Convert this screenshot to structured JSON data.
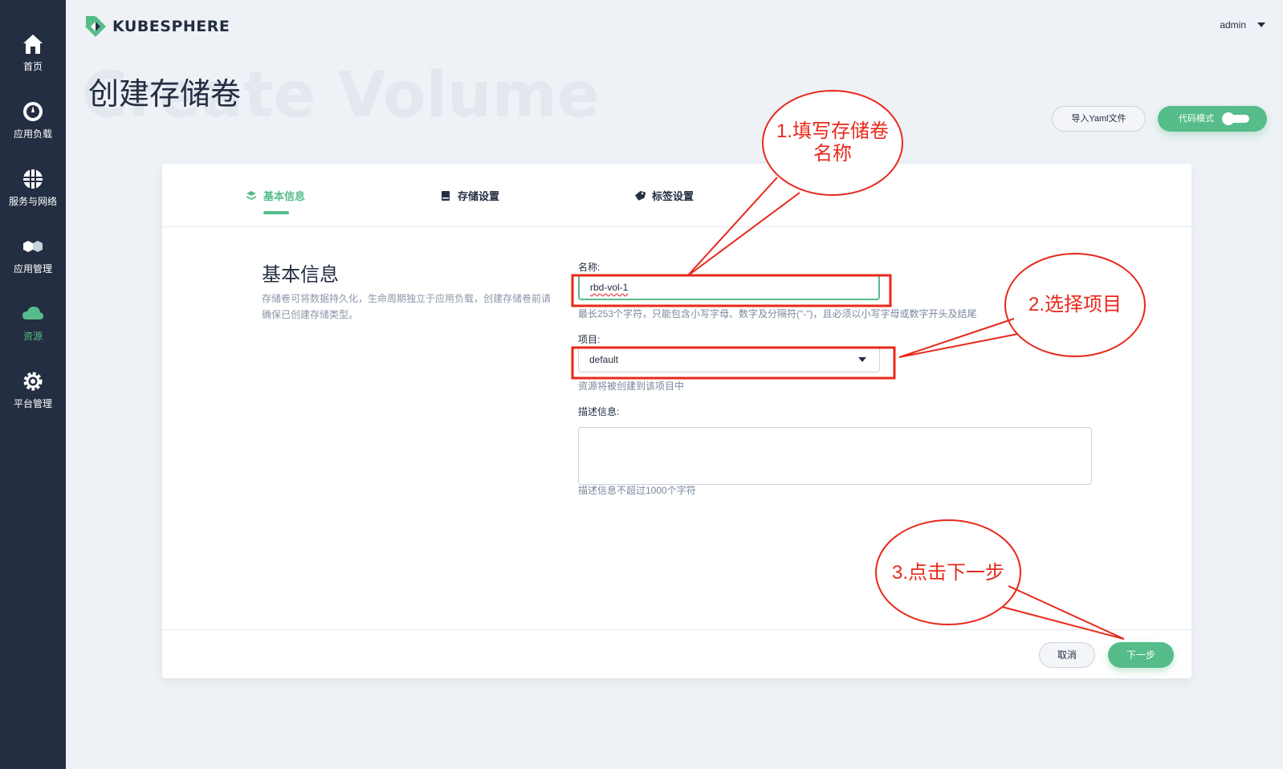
{
  "brand": {
    "name": "KUBESPHERE"
  },
  "user": {
    "name": "admin"
  },
  "sidebar": {
    "items": [
      {
        "label": "首页",
        "icon": "home-icon"
      },
      {
        "label": "应用负载",
        "icon": "dashboard-icon"
      },
      {
        "label": "服务与网络",
        "icon": "network-icon"
      },
      {
        "label": "应用管理",
        "icon": "hexagons-icon"
      },
      {
        "label": "资源",
        "icon": "cloud-icon",
        "active": true
      },
      {
        "label": "平台管理",
        "icon": "gear-icon"
      }
    ]
  },
  "page": {
    "title": "创建存储卷",
    "title_bg": "Create Volume",
    "import_yaml_label": "导入Yaml文件",
    "code_mode_label": "代码模式"
  },
  "tabs": [
    {
      "label": "基本信息",
      "icon": "layers-icon",
      "active": true
    },
    {
      "label": "存储设置",
      "icon": "storage-icon"
    },
    {
      "label": "标签设置",
      "icon": "tag-icon"
    }
  ],
  "section": {
    "title": "基本信息",
    "description": "存储卷可将数据持久化，生命周期独立于应用负载，创建存储卷前请确保已创建存储类型。"
  },
  "form": {
    "name": {
      "label": "名称:",
      "value": "rbd-vol-1",
      "help": "最长253个字符，只能包含小写字母、数字及分隔符(\"-\")，且必须以小写字母或数字开头及结尾"
    },
    "project": {
      "label": "项目:",
      "value": "default",
      "help": "资源将被创建到该项目中"
    },
    "description": {
      "label": "描述信息:",
      "value": "",
      "help": "描述信息不超过1000个字符"
    }
  },
  "footer": {
    "cancel_label": "取消",
    "next_label": "下一步"
  },
  "annotations": [
    {
      "text": "1.填写存储卷\n名称"
    },
    {
      "text": "2.选择项目"
    },
    {
      "text": "3.点击下一步"
    }
  ],
  "colors": {
    "accent": "#55bc8a",
    "sidebar": "#242e42",
    "annotation": "#e8291b"
  }
}
